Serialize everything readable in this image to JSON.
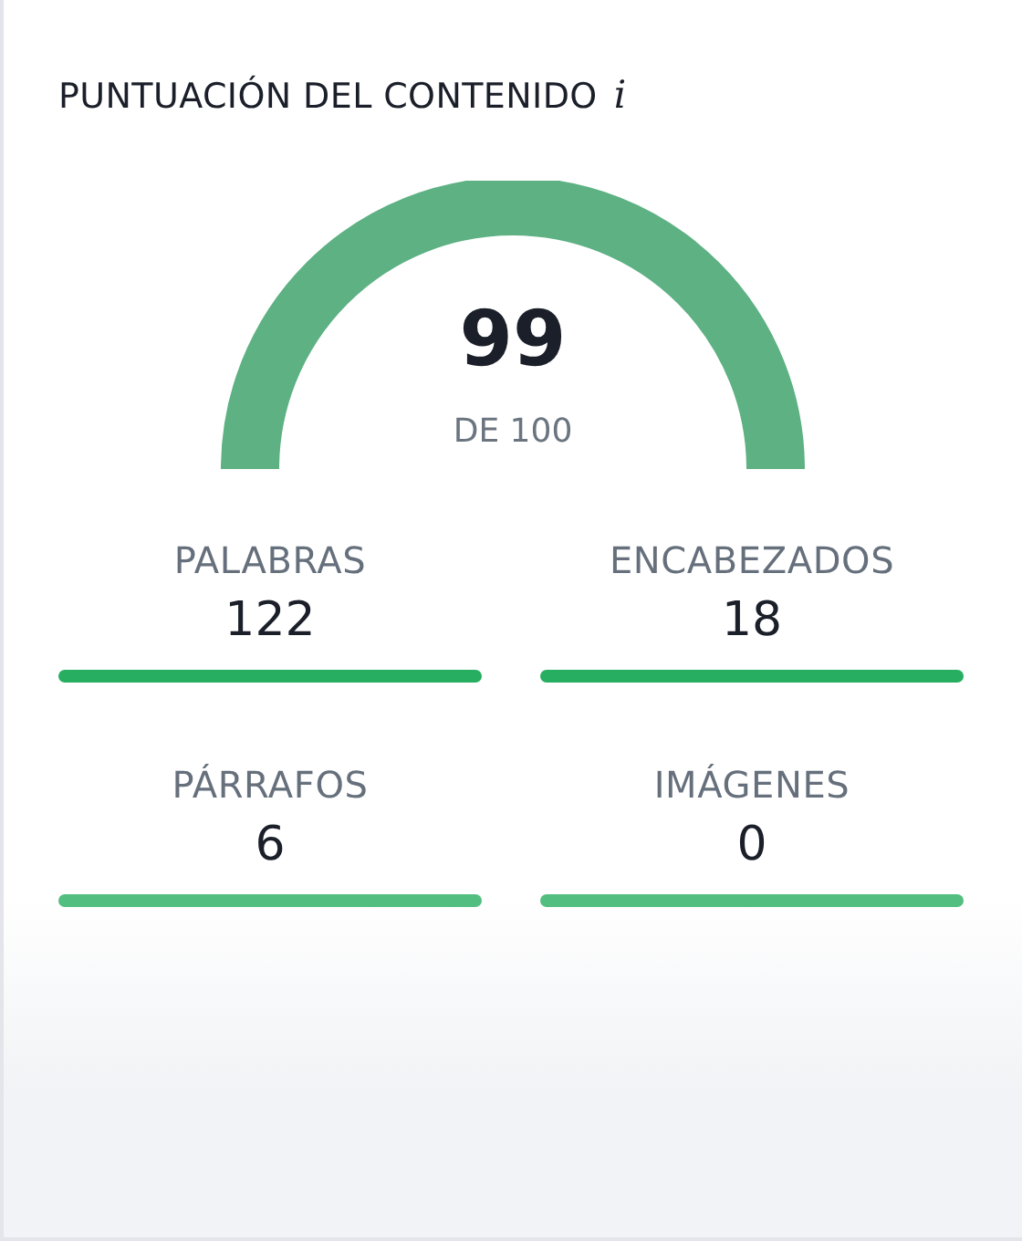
{
  "title": "PUNTUACIÓN DEL CONTENIDO",
  "info_icon": "i",
  "gauge": {
    "score": "99",
    "caption": "DE 100"
  },
  "stats": [
    {
      "label": "PALABRAS",
      "value": "122",
      "color": "#27ae60"
    },
    {
      "label": "ENCABEZADOS",
      "value": "18",
      "color": "#27ae60"
    },
    {
      "label": "PÁRRAFOS",
      "value": "6",
      "color": "#52be80"
    },
    {
      "label": "IMÁGENES",
      "value": "0",
      "color": "#52be80"
    }
  ]
}
